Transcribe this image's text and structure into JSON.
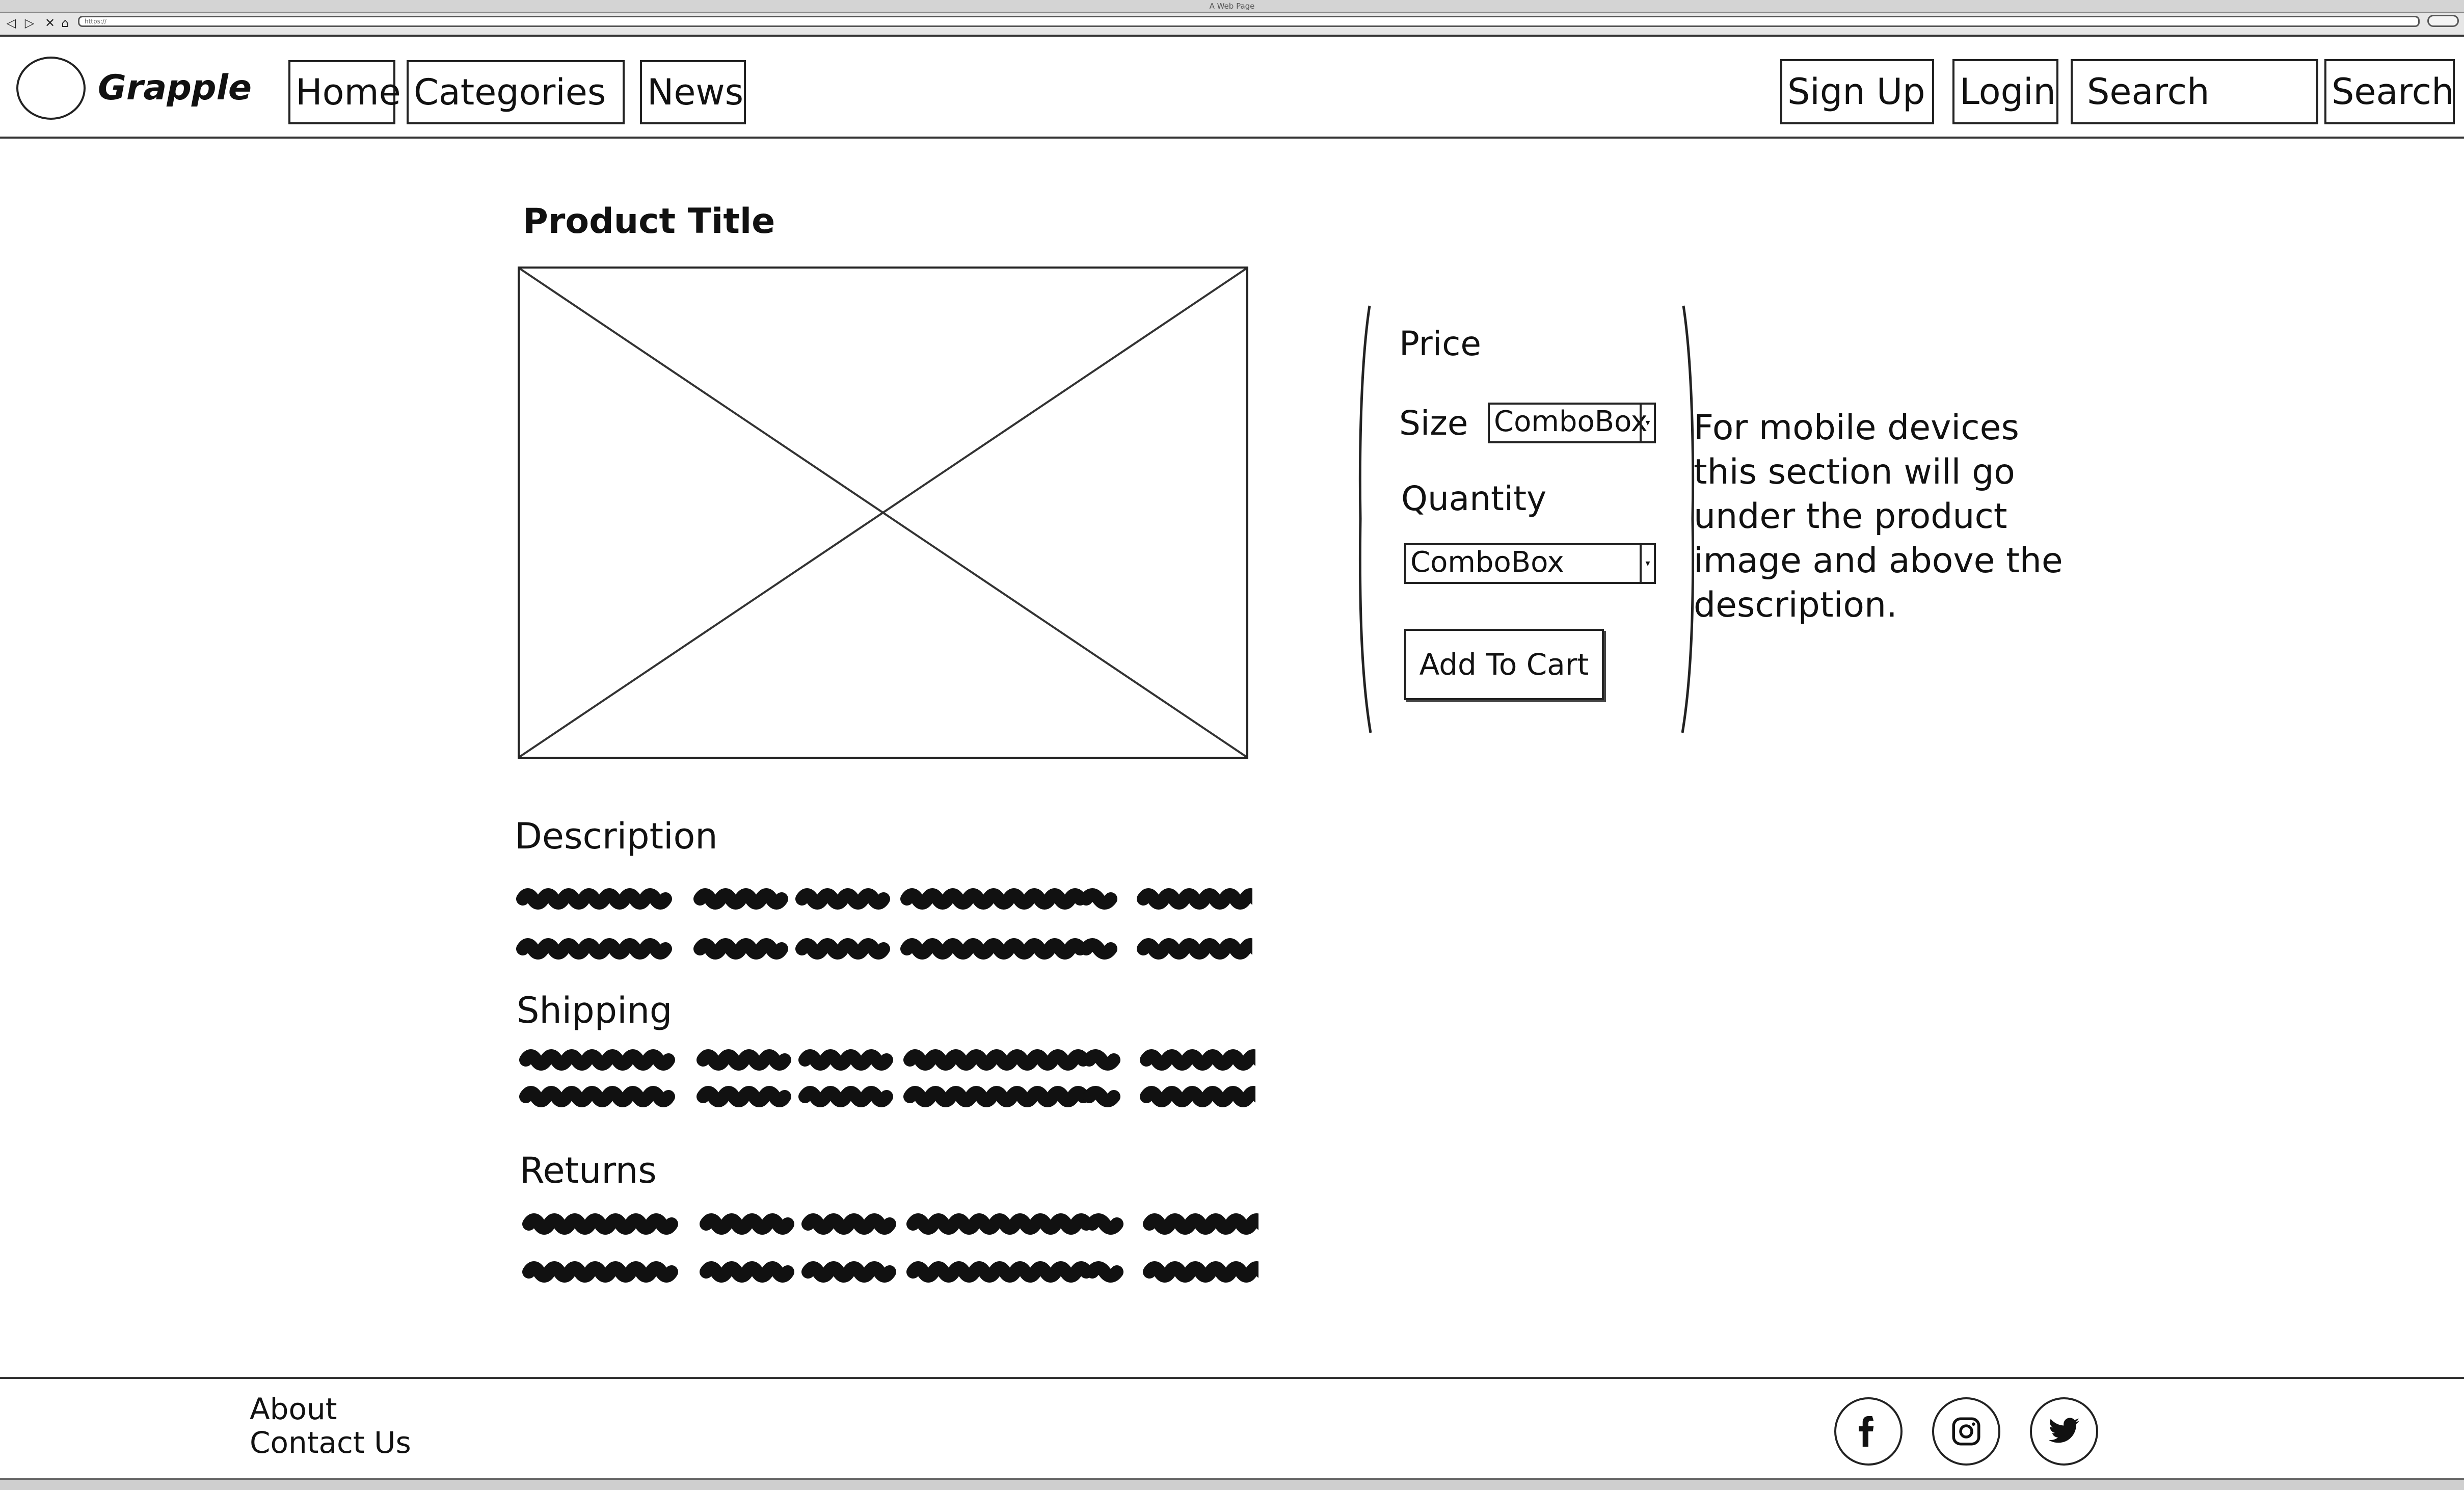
{
  "window": {
    "title": "A Web Page",
    "url": "https://"
  },
  "browser_icons": [
    "back-icon",
    "forward-icon",
    "stop-icon",
    "home-icon"
  ],
  "header": {
    "brand": "Grapple",
    "nav": {
      "home": "Home",
      "categories": "Categories",
      "news": "News"
    },
    "sign_up": "Sign Up",
    "login": "Login",
    "search": {
      "value": "Search",
      "button": "Search"
    }
  },
  "product": {
    "title": "Product Title",
    "price_label": "Price",
    "size_label": "Size",
    "size_value": "ComboBox",
    "quantity_label": "Quantity",
    "quantity_value": "ComboBox",
    "add_to_cart": "Add To Cart",
    "note": "For mobile devices this section will go under the product image and above the description."
  },
  "sections": {
    "description": "Description",
    "shipping": "Shipping",
    "returns": "Returns"
  },
  "footer": {
    "about": "About",
    "contact": "Contact Us",
    "social_icons": [
      "facebook-icon",
      "instagram-icon",
      "twitter-icon"
    ]
  }
}
